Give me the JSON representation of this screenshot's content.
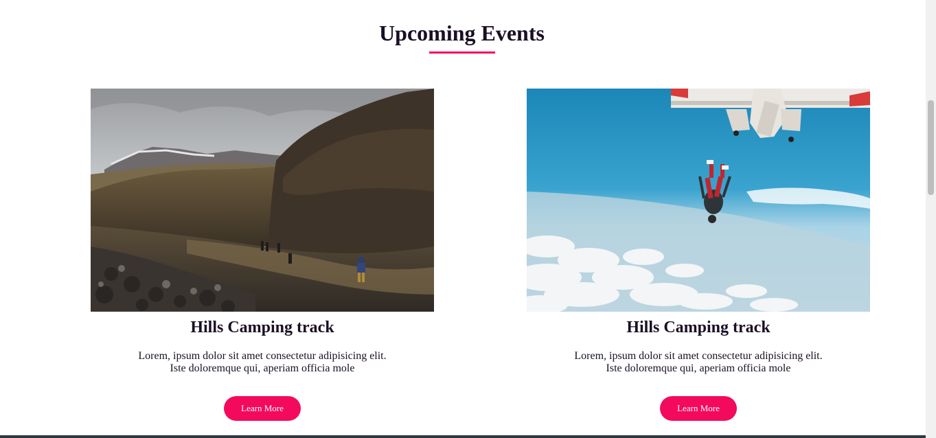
{
  "section": {
    "title": "Upcoming Events",
    "accent_color": "#f30a5c"
  },
  "events": [
    {
      "image_icon": "mountain-hikers-photo",
      "title": "Hills Camping track",
      "description_line1": "Lorem, ipsum dolor sit amet consectetur adipisicing elit.",
      "description_line2": "Iste doloremque qui, aperiam officia mole",
      "button_label": "Learn More"
    },
    {
      "image_icon": "skydiving-photo",
      "title": "Hills Camping track",
      "description_line1": "Lorem, ipsum dolor sit amet consectetur adipisicing elit.",
      "description_line2": "Iste doloremque qui, aperiam officia mole",
      "button_label": "Learn More"
    }
  ],
  "colors": {
    "button_bg": "#f30a5c",
    "text": "#1a0f24"
  }
}
